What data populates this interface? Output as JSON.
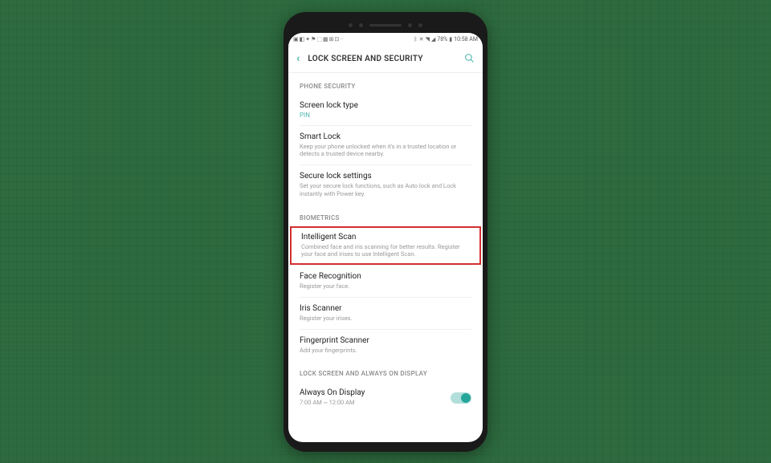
{
  "status_bar": {
    "battery_pct": "78%",
    "time": "10:58 AM"
  },
  "header": {
    "title": "LOCK SCREEN AND SECURITY"
  },
  "sections": {
    "phone_security": {
      "label": "PHONE SECURITY",
      "items": {
        "screen_lock": {
          "title": "Screen lock type",
          "value": "PIN"
        },
        "smart_lock": {
          "title": "Smart Lock",
          "subtitle": "Keep your phone unlocked when it's in a trusted location or detects a trusted device nearby."
        },
        "secure_lock": {
          "title": "Secure lock settings",
          "subtitle": "Set your secure lock functions, such as Auto lock and Lock instantly with Power key."
        }
      }
    },
    "biometrics": {
      "label": "BIOMETRICS",
      "items": {
        "intelligent_scan": {
          "title": "Intelligent Scan",
          "subtitle": "Combined face and iris scanning for better results. Register your face and irises to use Intelligent Scan."
        },
        "face_recognition": {
          "title": "Face Recognition",
          "subtitle": "Register your face."
        },
        "iris_scanner": {
          "title": "Iris Scanner",
          "subtitle": "Register your irises."
        },
        "fingerprint": {
          "title": "Fingerprint Scanner",
          "subtitle": "Add your fingerprints."
        }
      }
    },
    "lock_screen_aod": {
      "label": "LOCK SCREEN AND ALWAYS ON DISPLAY",
      "items": {
        "always_on": {
          "title": "Always On Display",
          "subtitle": "7:00 AM ~ 12:00 AM",
          "toggle": true
        }
      }
    }
  }
}
